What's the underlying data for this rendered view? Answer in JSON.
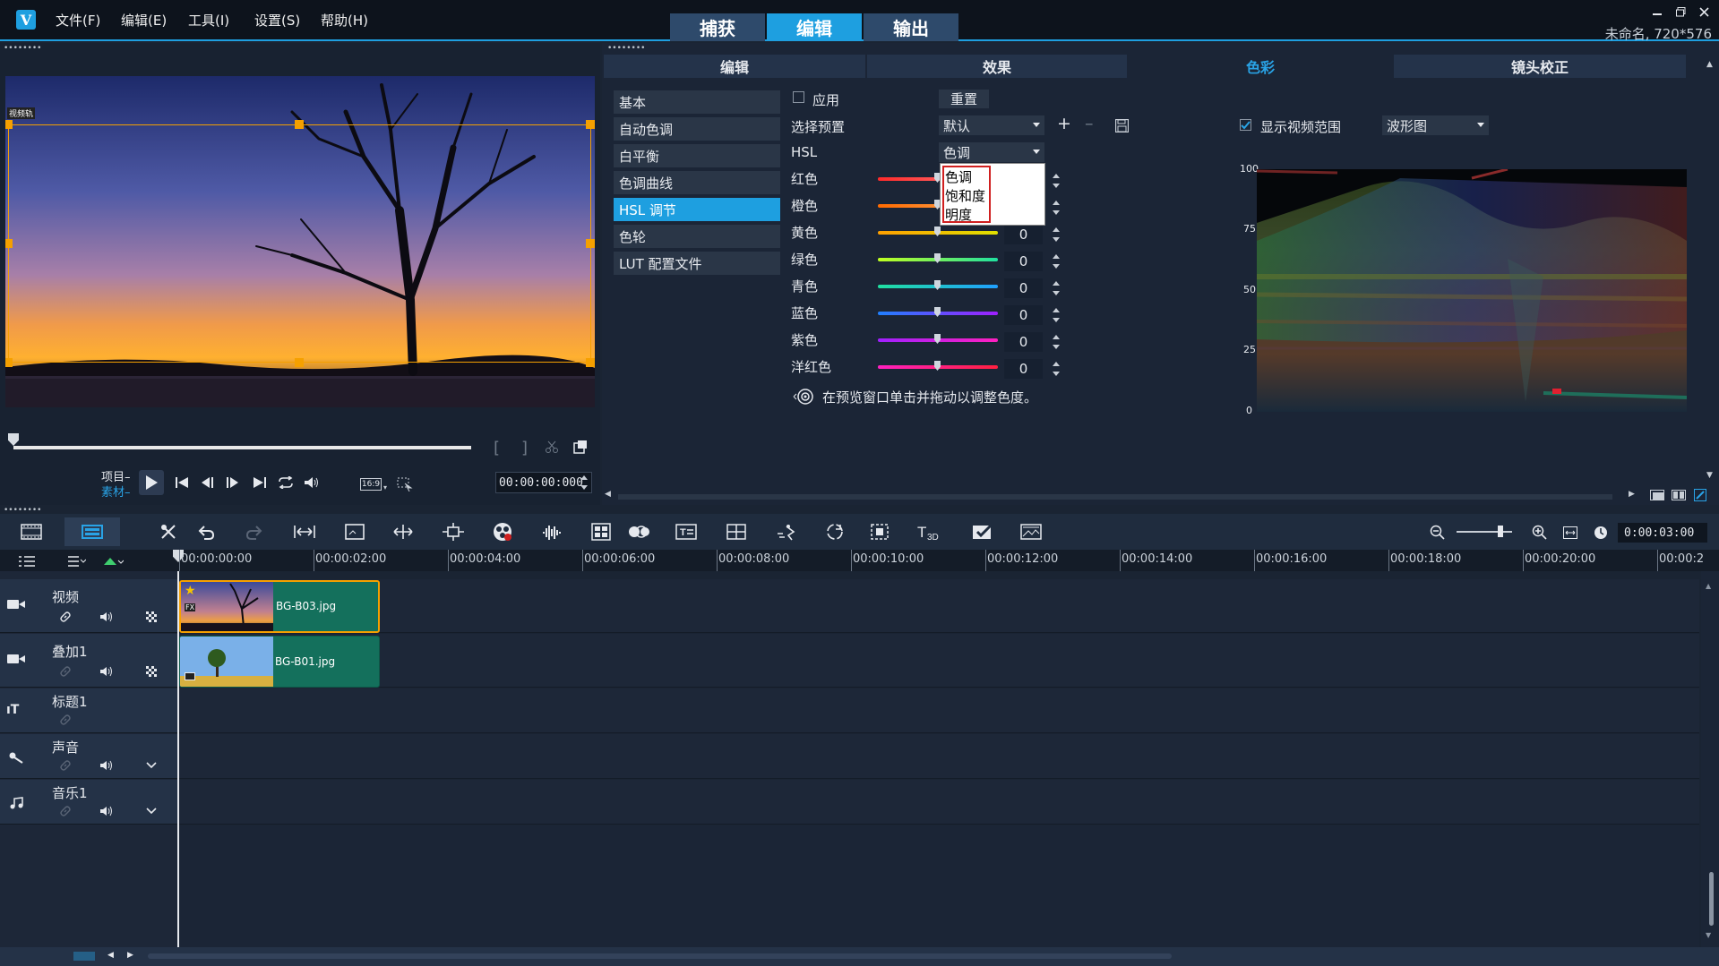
{
  "menu": {
    "file": "文件(F)",
    "edit": "编辑(E)",
    "tools": "工具(I)",
    "settings": "设置(S)",
    "help": "帮助(H)"
  },
  "workspace_tabs": {
    "capture": "捕获",
    "edit": "编辑",
    "output": "输出"
  },
  "project_info": "未命名, 720*576",
  "player": {
    "overlay_label": "视频轨",
    "mode_project": "项目",
    "mode_clip": "素材",
    "aspect": "16:9",
    "timecode": "00:00:00:000"
  },
  "tabs": {
    "edit": "编辑",
    "effect": "效果",
    "color": "色彩",
    "lens": "镜头校正"
  },
  "color_panel": {
    "side": [
      "基本",
      "自动色调",
      "白平衡",
      "色调曲线",
      "HSL 调节",
      "色轮",
      "LUT 配置文件"
    ],
    "apply": "应用",
    "reset": "重置",
    "preset_label": "选择预置",
    "preset_value": "默认",
    "hsl_label": "HSL",
    "hsl_value": "色调",
    "hsl_options": [
      "色调",
      "饱和度",
      "明度"
    ],
    "channels": [
      {
        "name": "红色",
        "value": "0"
      },
      {
        "name": "橙色",
        "value": "0"
      },
      {
        "name": "黄色",
        "value": "0"
      },
      {
        "name": "绿色",
        "value": "0"
      },
      {
        "name": "青色",
        "value": "0"
      },
      {
        "name": "蓝色",
        "value": "0"
      },
      {
        "name": "紫色",
        "value": "0"
      },
      {
        "name": "洋红色",
        "value": "0"
      }
    ],
    "hint": "在预览窗口单击并拖动以调整色度。",
    "show_scope": "显示视频范围",
    "scope_type": "波形图",
    "scope_axis": [
      "100",
      "75",
      "50",
      "25",
      "0"
    ]
  },
  "timeline": {
    "duration": "0:00:03:00",
    "ruler": [
      "00:00:00:00",
      "00:00:02:00",
      "00:00:04:00",
      "00:00:06:00",
      "00:00:08:00",
      "00:00:10:00",
      "00:00:12:00",
      "00:00:14:00",
      "00:00:16:00",
      "00:00:18:00",
      "00:00:20:00",
      "00:00:2"
    ],
    "tracks": [
      "视频",
      "叠加1",
      "标题1",
      "声音",
      "音乐1"
    ],
    "clips": {
      "video": "BG-B03.jpg",
      "overlay": "BG-B01.jpg",
      "fx": "FX"
    }
  },
  "colors": {
    "accent": "#1e9fe0",
    "clip": "#14705c",
    "handle": "#f5a000"
  }
}
